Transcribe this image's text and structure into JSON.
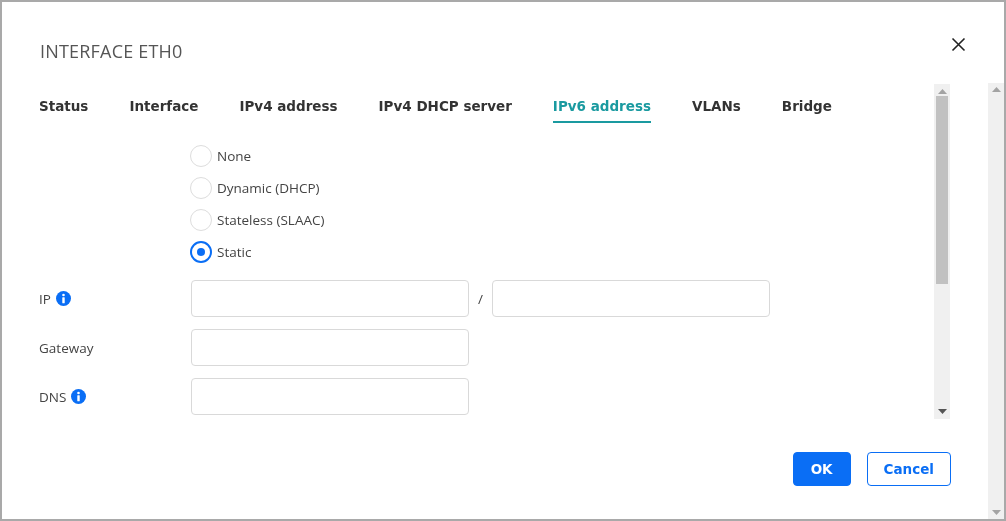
{
  "dialog": {
    "title": "INTERFACE ETH0"
  },
  "tabs": [
    {
      "label": "Status",
      "selected": false
    },
    {
      "label": "Interface",
      "selected": false
    },
    {
      "label": "IPv4 address",
      "selected": false
    },
    {
      "label": "IPv4 DHCP server",
      "selected": false
    },
    {
      "label": "IPv6 address",
      "selected": true
    },
    {
      "label": "VLANs",
      "selected": false
    },
    {
      "label": "Bridge",
      "selected": false
    }
  ],
  "mode_options": [
    {
      "label": "None",
      "selected": false
    },
    {
      "label": "Dynamic (DHCP)",
      "selected": false
    },
    {
      "label": "Stateless (SLAAC)",
      "selected": false
    },
    {
      "label": "Static",
      "selected": true
    }
  ],
  "fields": [
    {
      "label": "IP",
      "info": true,
      "separator": "/"
    },
    {
      "label": "Gateway",
      "info": false
    },
    {
      "label": "DNS",
      "info": true
    }
  ],
  "buttons": [
    {
      "label": "OK",
      "kind": "primary"
    },
    {
      "label": "Cancel",
      "kind": "secondary"
    }
  ]
}
